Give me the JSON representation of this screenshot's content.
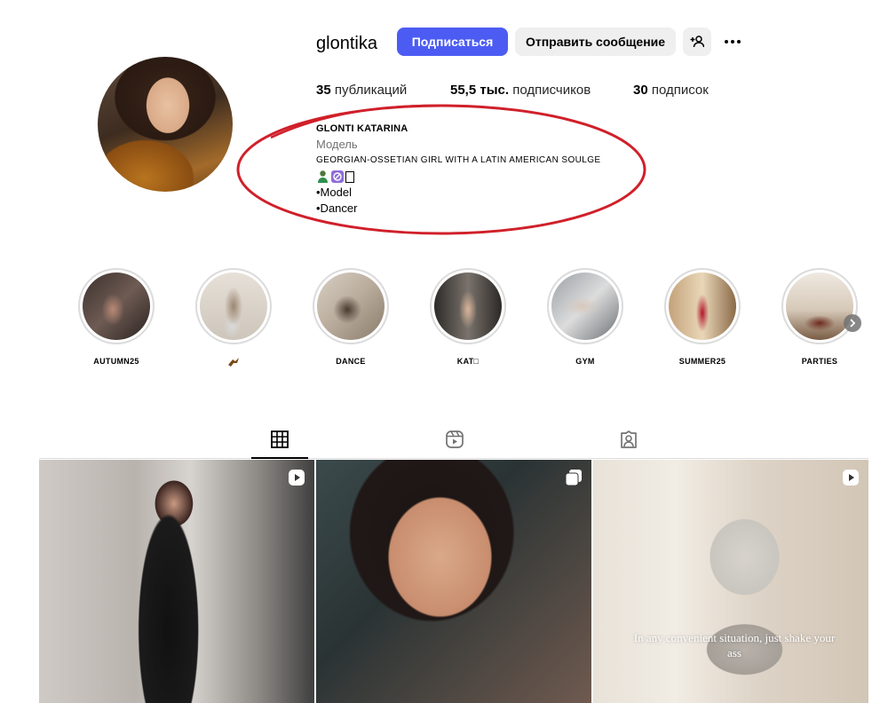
{
  "profile": {
    "username": "glontika",
    "follow_label": "Подписаться",
    "message_label": "Отправить сообщение",
    "stats": {
      "posts_count": "35",
      "posts_label": "публикаций",
      "followers_count": "55,5 тыс.",
      "followers_label": "подписчиков",
      "following_count": "30",
      "following_label": "подписок"
    },
    "bio": {
      "name": "GLONTI KATARINA",
      "category": "Модель",
      "tagline": "Georgian-Ossetian girl with a Latin American Soulge",
      "line_model": "•Model",
      "line_dancer": "•Dancer"
    }
  },
  "highlights": [
    {
      "label": "autumn25"
    },
    {
      "label": ""
    },
    {
      "label": "dance"
    },
    {
      "label": "kat□"
    },
    {
      "label": "gym"
    },
    {
      "label": "summer25"
    },
    {
      "label": "parties"
    }
  ],
  "tabs": [
    "grid-icon",
    "reels-icon",
    "tagged-icon"
  ],
  "posts": [
    {
      "type": "reel"
    },
    {
      "type": "carousel"
    },
    {
      "type": "reel",
      "caption": "In any convenient situation, just shake your ass"
    }
  ],
  "colors": {
    "accent": "#4c5cf3",
    "secondary_button": "#efefef",
    "annotation_ellipse": "#d0202a"
  }
}
